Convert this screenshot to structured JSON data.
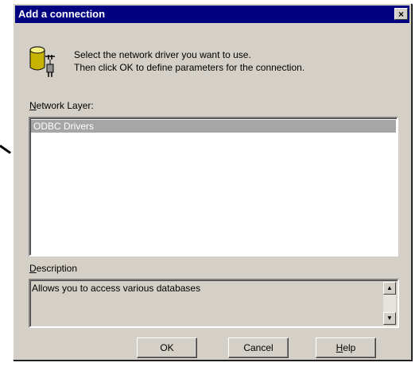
{
  "dialog": {
    "title": "Add a connection",
    "close_glyph": "×",
    "icon": "database-plug-icon",
    "instruction_line1": "Select the network driver you want to use.",
    "instruction_line2": "Then click OK to define parameters for the connection.",
    "network_layer_label_first": "N",
    "network_layer_label_rest": "etwork Layer:",
    "network_layer_items": [
      "ODBC Drivers"
    ],
    "description_label_first": "D",
    "description_label_rest": "escription",
    "description_text": "Allows you to access various databases",
    "buttons": {
      "ok": "OK",
      "cancel": "Cancel",
      "help_first": "H",
      "help_rest": "elp"
    }
  }
}
